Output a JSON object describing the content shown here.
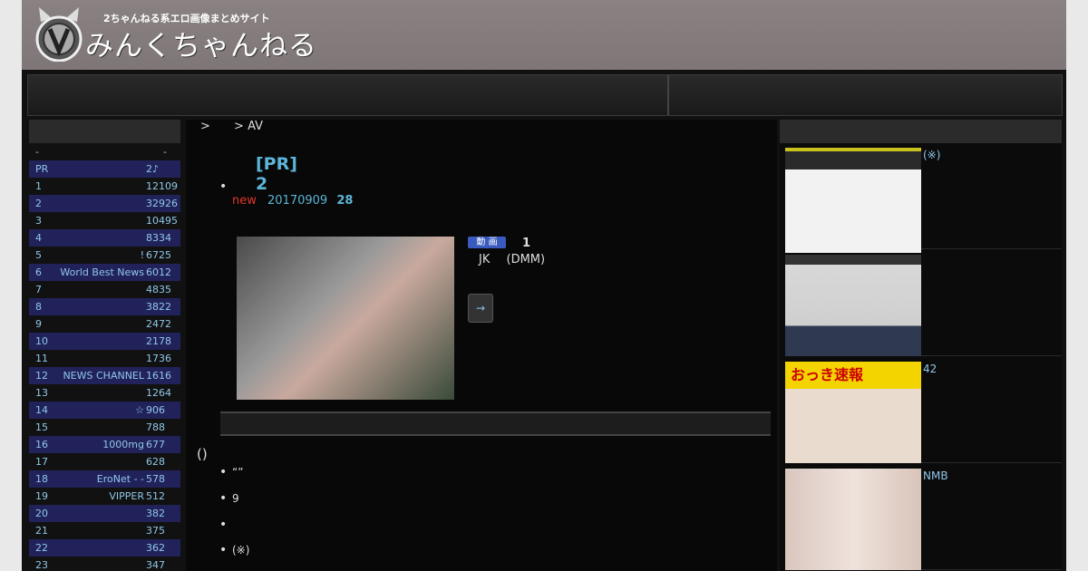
{
  "header": {
    "tagline": "2ちゃんねる系エロ画像まとめサイト",
    "site_title": "みんくちゃんねる"
  },
  "breadcrumb": {
    "arrow1": ">",
    "arrow2": "> AV"
  },
  "entry": {
    "title_line1": "[PR]",
    "title_line2": "2",
    "new_label": "new",
    "date": "20170909",
    "comments": "28",
    "video_badge": "動 画",
    "video_count": "1",
    "video_label_a": "JK",
    "video_label_b": "(DMM)",
    "arrow_label": "→"
  },
  "related": {
    "title": "()",
    "items": [
      "“”",
      "9",
      "",
      "(※)"
    ]
  },
  "ranking": {
    "header_left": "-",
    "header_right": "-",
    "rows": [
      {
        "num": "PR",
        "name": "",
        "count": "2♪"
      },
      {
        "num": "1",
        "name": "",
        "count": "12109"
      },
      {
        "num": "2",
        "name": "",
        "count": "32926"
      },
      {
        "num": "3",
        "name": "",
        "count": "10495"
      },
      {
        "num": "4",
        "name": "",
        "count": "8334"
      },
      {
        "num": "5",
        "name": "!",
        "count": "6725"
      },
      {
        "num": "6",
        "name": "World Best News",
        "count": "6012"
      },
      {
        "num": "7",
        "name": "",
        "count": "4835"
      },
      {
        "num": "8",
        "name": "",
        "count": "3822"
      },
      {
        "num": "9",
        "name": "",
        "count": "2472"
      },
      {
        "num": "10",
        "name": "",
        "count": "2178"
      },
      {
        "num": "11",
        "name": "",
        "count": "1736"
      },
      {
        "num": "12",
        "name": "NEWS CHANNEL",
        "count": "1616"
      },
      {
        "num": "13",
        "name": "",
        "count": "1264"
      },
      {
        "num": "14",
        "name": "☆",
        "count": "906"
      },
      {
        "num": "15",
        "name": "",
        "count": "788"
      },
      {
        "num": "16",
        "name": "1000mg",
        "count": "677"
      },
      {
        "num": "17",
        "name": "",
        "count": "628"
      },
      {
        "num": "18",
        "name": "EroNet - -",
        "count": "578"
      },
      {
        "num": "19",
        "name": "VIPPER",
        "count": "512"
      },
      {
        "num": "20",
        "name": "",
        "count": "382"
      },
      {
        "num": "21",
        "name": "",
        "count": "375"
      },
      {
        "num": "22",
        "name": "",
        "count": "362"
      },
      {
        "num": "23",
        "name": "",
        "count": "347"
      }
    ]
  },
  "right_sidebar": [
    {
      "label": "(※)"
    },
    {
      "label": ""
    },
    {
      "label": "42",
      "banner": "おっき速報"
    },
    {
      "label": "NMB"
    }
  ]
}
